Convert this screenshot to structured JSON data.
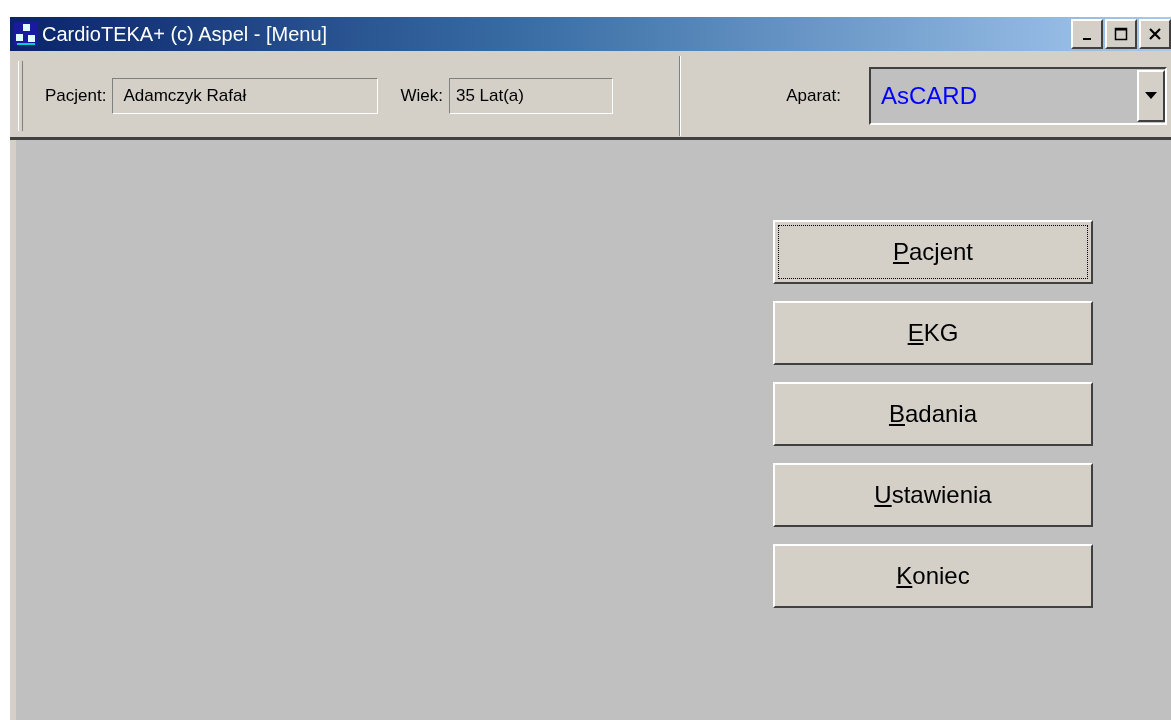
{
  "window": {
    "title": "CardioTEKA+ (c) Aspel - [Menu]"
  },
  "header": {
    "patient_label": "Pacjent:",
    "patient_value": "Adamczyk Rafał",
    "age_label": "Wiek:",
    "age_value": "35 Lat(a)",
    "device_label": "Aparat:",
    "device_value": "AsCARD"
  },
  "buttons": [
    {
      "label": "Pacjent",
      "focused": true
    },
    {
      "label": "EKG",
      "focused": false
    },
    {
      "label": "Badania",
      "focused": false
    },
    {
      "label": "Ustawienia",
      "focused": false
    },
    {
      "label": "Koniec",
      "focused": false
    }
  ]
}
